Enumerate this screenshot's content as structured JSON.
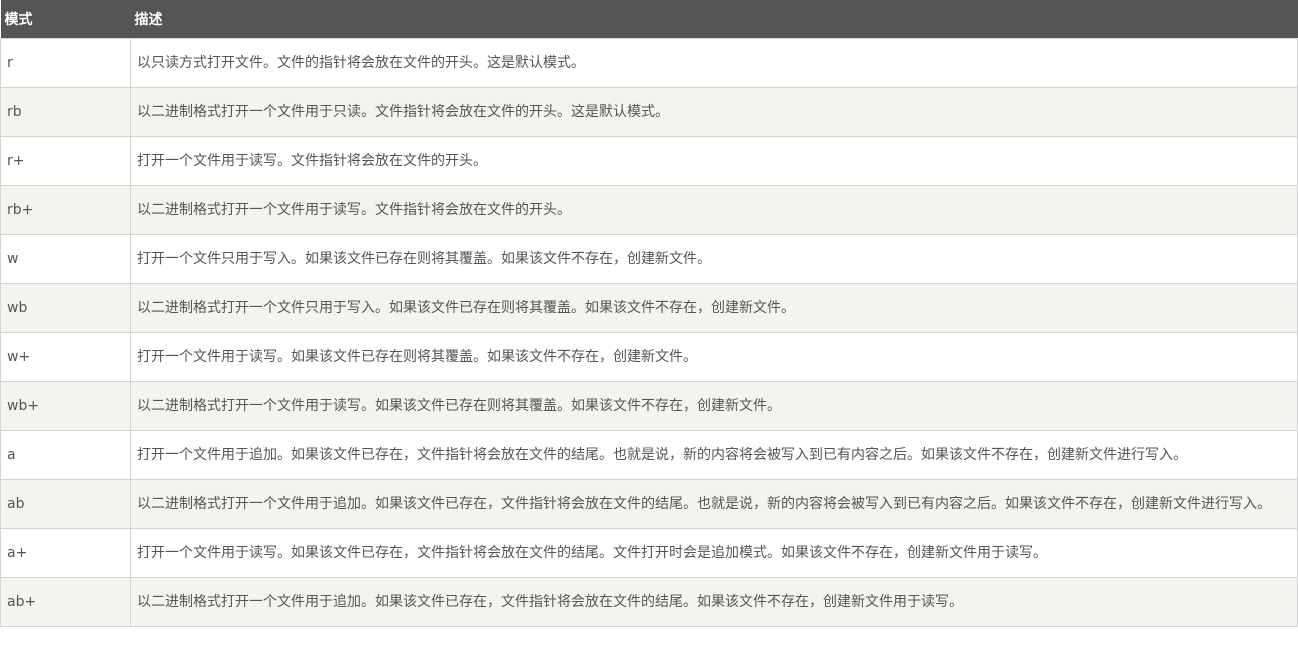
{
  "table": {
    "headers": {
      "mode": "模式",
      "description": "描述"
    },
    "rows": [
      {
        "mode": "r",
        "description": "以只读方式打开文件。文件的指针将会放在文件的开头。这是默认模式。"
      },
      {
        "mode": "rb",
        "description": "以二进制格式打开一个文件用于只读。文件指针将会放在文件的开头。这是默认模式。"
      },
      {
        "mode": "r+",
        "description": "打开一个文件用于读写。文件指针将会放在文件的开头。"
      },
      {
        "mode": "rb+",
        "description": "以二进制格式打开一个文件用于读写。文件指针将会放在文件的开头。"
      },
      {
        "mode": "w",
        "description": "打开一个文件只用于写入。如果该文件已存在则将其覆盖。如果该文件不存在，创建新文件。"
      },
      {
        "mode": "wb",
        "description": "以二进制格式打开一个文件只用于写入。如果该文件已存在则将其覆盖。如果该文件不存在，创建新文件。"
      },
      {
        "mode": "w+",
        "description": "打开一个文件用于读写。如果该文件已存在则将其覆盖。如果该文件不存在，创建新文件。"
      },
      {
        "mode": "wb+",
        "description": "以二进制格式打开一个文件用于读写。如果该文件已存在则将其覆盖。如果该文件不存在，创建新文件。"
      },
      {
        "mode": "a",
        "description": "打开一个文件用于追加。如果该文件已存在，文件指针将会放在文件的结尾。也就是说，新的内容将会被写入到已有内容之后。如果该文件不存在，创建新文件进行写入。"
      },
      {
        "mode": "ab",
        "description": "以二进制格式打开一个文件用于追加。如果该文件已存在，文件指针将会放在文件的结尾。也就是说，新的内容将会被写入到已有内容之后。如果该文件不存在，创建新文件进行写入。"
      },
      {
        "mode": "a+",
        "description": "打开一个文件用于读写。如果该文件已存在，文件指针将会放在文件的结尾。文件打开时会是追加模式。如果该文件不存在，创建新文件用于读写。"
      },
      {
        "mode": "ab+",
        "description": "以二进制格式打开一个文件用于追加。如果该文件已存在，文件指针将会放在文件的结尾。如果该文件不存在，创建新文件用于读写。"
      }
    ]
  }
}
